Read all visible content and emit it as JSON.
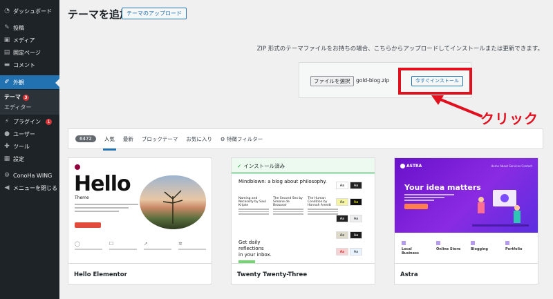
{
  "sidebar": {
    "items": [
      {
        "label": "ダッシュボード",
        "icon": "dashboard-icon"
      },
      {
        "label": "投稿",
        "icon": "pin-icon"
      },
      {
        "label": "メディア",
        "icon": "media-icon"
      },
      {
        "label": "固定ページ",
        "icon": "page-icon"
      },
      {
        "label": "コメント",
        "icon": "comment-icon"
      },
      {
        "label": "外観",
        "icon": "brush-icon"
      },
      {
        "label": "プラグイン",
        "icon": "plugin-icon",
        "badge": "1"
      },
      {
        "label": "ユーザー",
        "icon": "user-icon"
      },
      {
        "label": "ツール",
        "icon": "wrench-icon"
      },
      {
        "label": "設定",
        "icon": "settings-icon"
      },
      {
        "label": "ConoHa WING",
        "icon": "gear-icon"
      },
      {
        "label": "メニューを閉じる",
        "icon": "collapse-icon"
      }
    ],
    "submenu": [
      {
        "label": "テーマ",
        "badge": "3"
      },
      {
        "label": "エディター"
      }
    ]
  },
  "header": {
    "title": "テーマを追加",
    "upload_button": "テーマのアップロード"
  },
  "upload": {
    "description": "ZIP 形式のテーマファイルをお持ちの場合、こちらからアップロードしてインストールまたは更新できます。",
    "choose_file": "ファイルを選択",
    "file_name": "gold-blog.zip",
    "install_button": "今すぐインストール"
  },
  "annotation": {
    "label": "クリック",
    "color": "#e0101f"
  },
  "filter_bar": {
    "count": "6472",
    "tabs": [
      "人気",
      "最新",
      "ブロックテーマ",
      "お気に入り"
    ],
    "feature_filter": "特徴フィルター"
  },
  "themes": [
    {
      "name": "Hello Elementor",
      "preview": {
        "title": "Hello",
        "subtitle": "Theme"
      }
    },
    {
      "name": "Twenty Twenty-Three",
      "installed_label": "インストール済み",
      "preview": {
        "headline": "Mindblown: a blog about philosophy.",
        "cols": [
          "Naming and Necessity by Saul Kripke",
          "The Second Sex by Simone de Beauvoir",
          "The Human Condition by Hannah Arendt"
        ],
        "daily": [
          "Get daily",
          "reflections",
          "in your inbox."
        ],
        "swatch_label": "Aa"
      }
    },
    {
      "name": "Astra",
      "preview": {
        "logo": "ASTRA",
        "nav": "Home   About   Services   Contact",
        "headline": "Your idea matters",
        "features": [
          "Local Business",
          "Online Store",
          "Blogging",
          "Portfolio"
        ]
      }
    }
  ],
  "colors": {
    "sidebar_bg": "#1d2327",
    "accent": "#2271b1",
    "badge": "#d63638"
  }
}
